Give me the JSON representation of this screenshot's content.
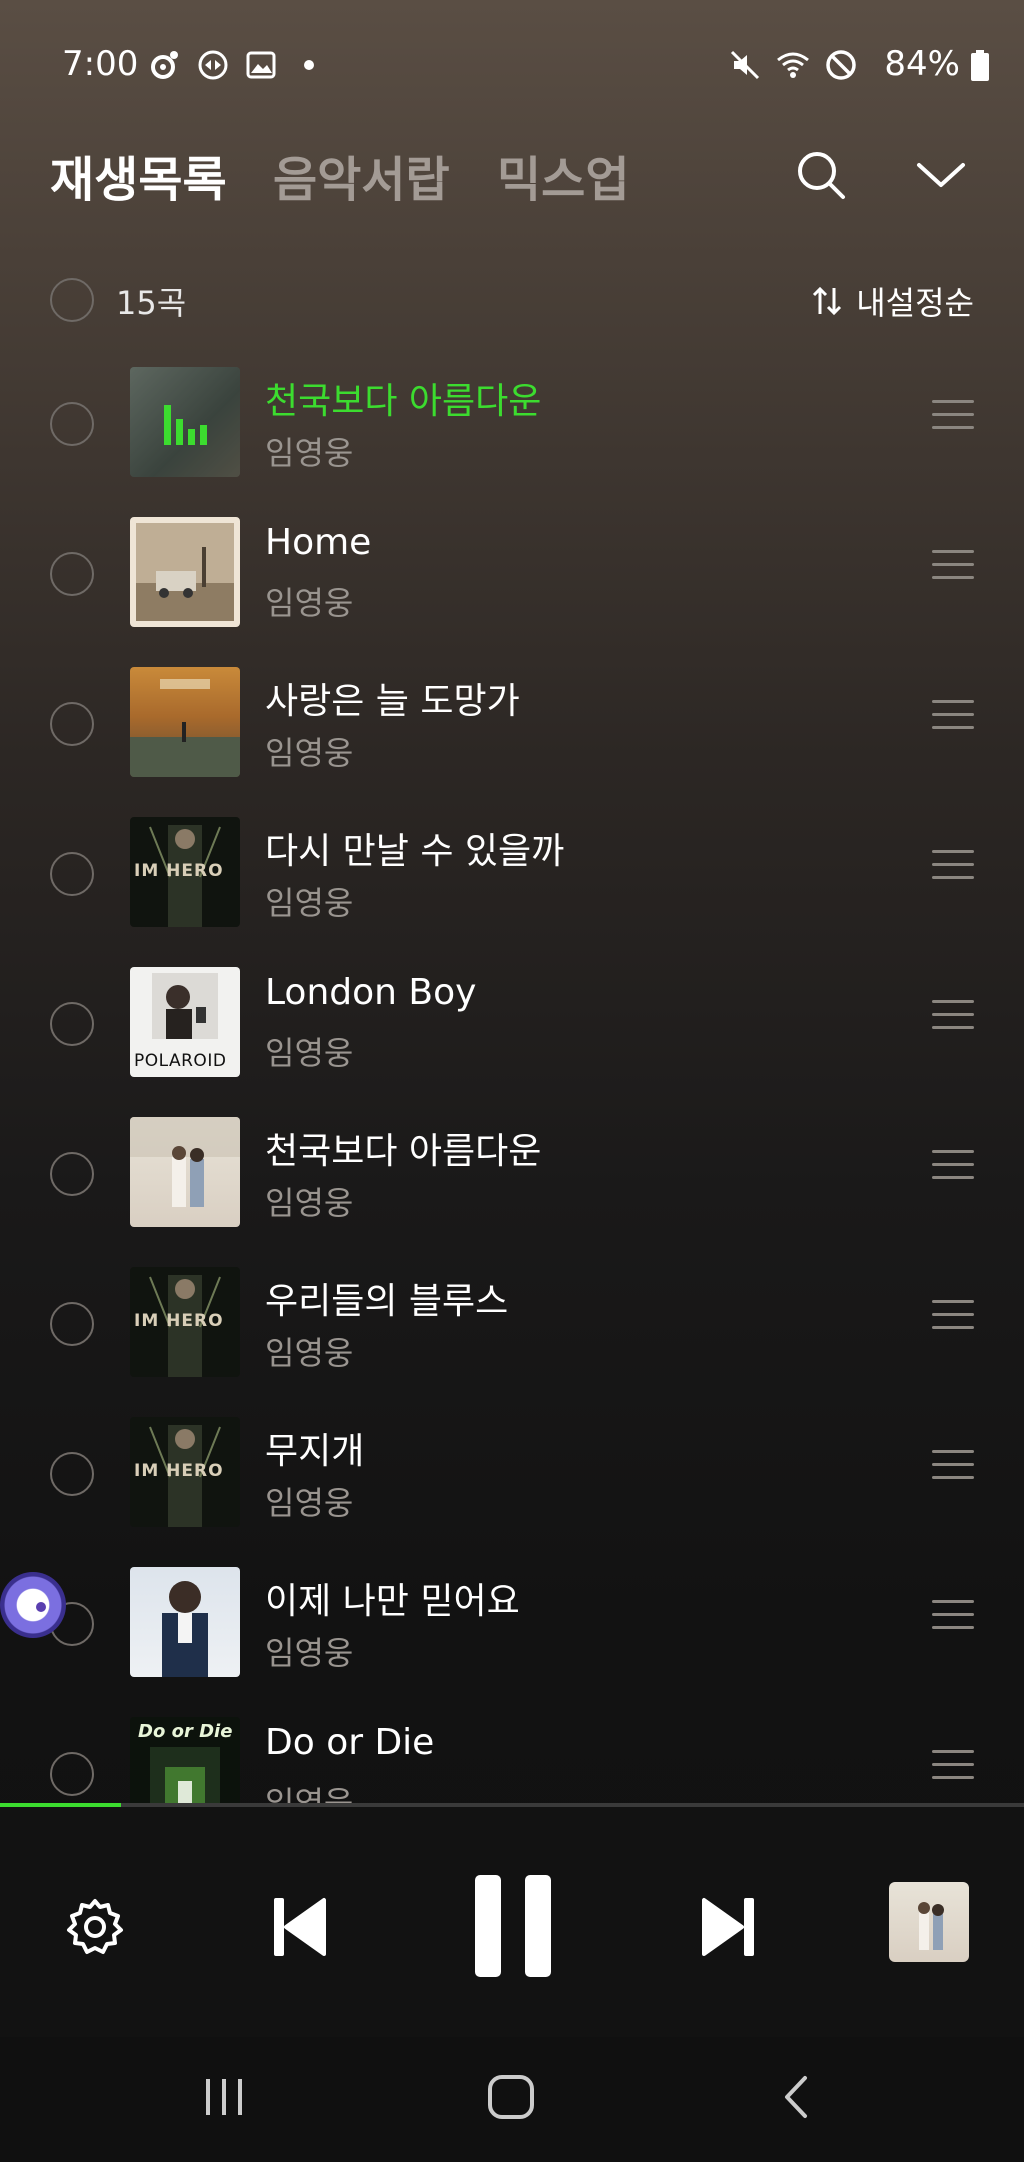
{
  "status_bar": {
    "time": "7:00",
    "battery": "84%",
    "left_icons": [
      "threads-icon",
      "sync-icon",
      "gallery-icon",
      "dot-icon"
    ],
    "right_icons": [
      "mute-icon",
      "wifi-icon",
      "do-not-disturb-icon",
      "battery-icon"
    ]
  },
  "header": {
    "tabs": [
      {
        "label": "재생목록",
        "active": true
      },
      {
        "label": "음악서랍",
        "active": false
      },
      {
        "label": "믹스업",
        "active": false
      }
    ],
    "icons": [
      "search-icon",
      "chevron-down-icon"
    ]
  },
  "list_header": {
    "count": "15곡",
    "sort_label": "내설정순"
  },
  "tracks": [
    {
      "title": "천국보다 아름다운",
      "artist": "임영웅",
      "playing": true
    },
    {
      "title": "Home",
      "artist": "임영웅",
      "playing": false
    },
    {
      "title": "사랑은 늘 도망가",
      "artist": "임영웅",
      "playing": false
    },
    {
      "title": "다시 만날 수 있을까",
      "artist": "임영웅",
      "playing": false
    },
    {
      "title": "London Boy",
      "artist": "임영웅",
      "playing": false
    },
    {
      "title": "천국보다 아름다운",
      "artist": "임영웅",
      "playing": false
    },
    {
      "title": "우리들의 블루스",
      "artist": "임영웅",
      "playing": false
    },
    {
      "title": "무지개",
      "artist": "임영웅",
      "playing": false
    },
    {
      "title": "이제 나만 믿어요",
      "artist": "임영웅",
      "playing": false
    },
    {
      "title": "Do or Die",
      "artist": "임영웅",
      "playing": false
    }
  ],
  "album_art_text": {
    "im_hero": "IM HERO",
    "polaroid": "POLAROID",
    "do_or_die": "Do or Die"
  },
  "player": {
    "progress_fraction": 0.118,
    "icons": [
      "settings-icon",
      "previous-icon",
      "pause-icon",
      "next-icon",
      "mini-album-art"
    ]
  },
  "colors": {
    "accent": "#3cdc2f",
    "secondary_text": "#9a9590",
    "inactive_tab": "#a39b95"
  }
}
